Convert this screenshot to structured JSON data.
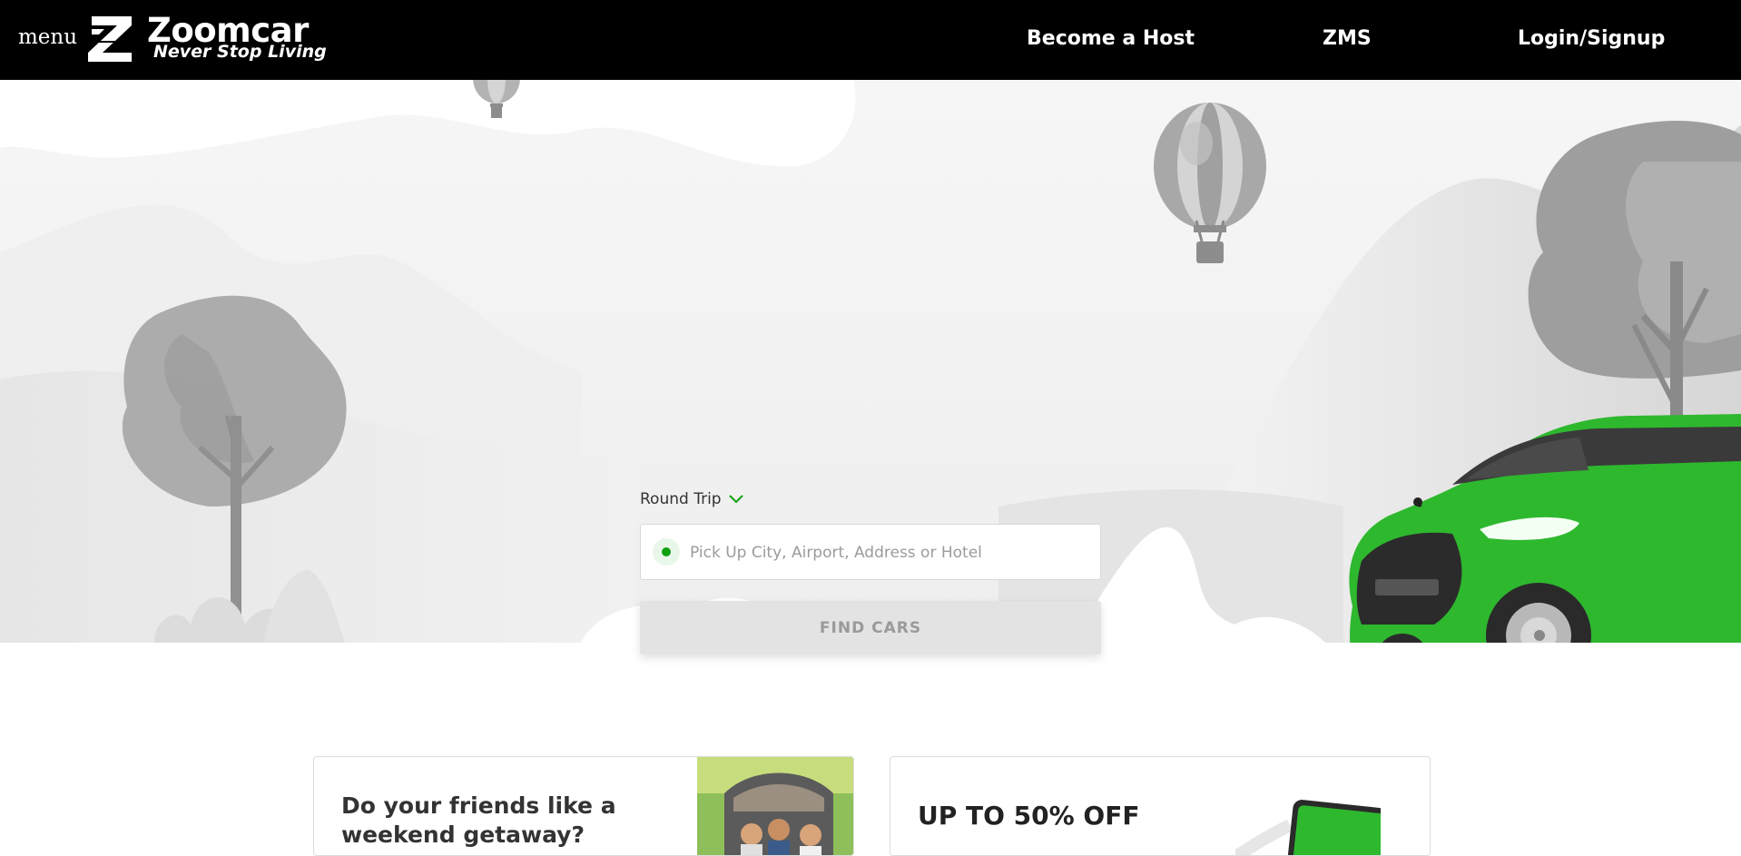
{
  "header": {
    "menu_label": "menu",
    "brand_name": "Zoomcar",
    "brand_tagline": "Never Stop Living",
    "nav": {
      "become_host": "Become a Host",
      "zms": "ZMS",
      "login": "Login/Signup"
    }
  },
  "search": {
    "trip_type": "Round Trip",
    "pickup_placeholder": "Pick Up City, Airport, Address or Hotel",
    "find_button": "FIND CARS"
  },
  "promos": [
    {
      "title": "Do your friends like a weekend getaway?"
    },
    {
      "title": "UP TO 50% OFF"
    }
  ],
  "colors": {
    "brand_green": "#10a012",
    "header_bg": "#000000",
    "car_green": "#2eb82e"
  }
}
